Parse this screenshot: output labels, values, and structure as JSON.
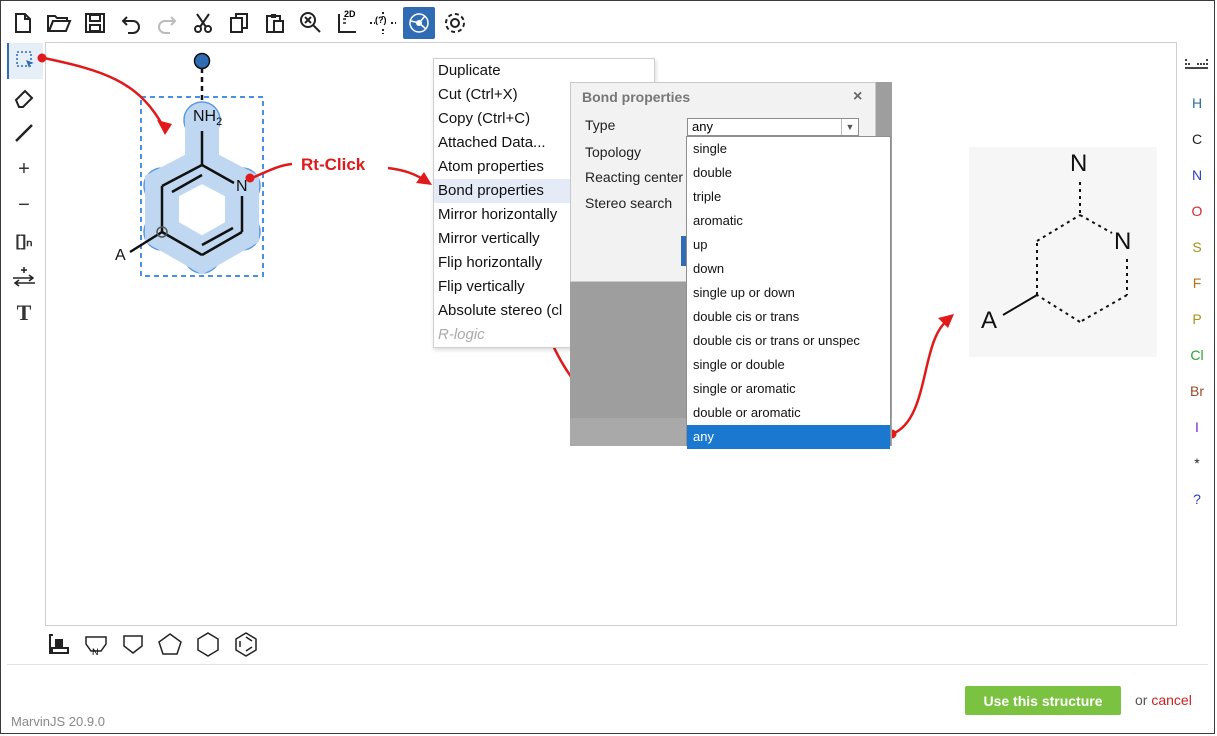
{
  "app": {
    "version": "MarvinJS 20.9.0"
  },
  "toolbar": {
    "icons": [
      "new-document-icon",
      "open-folder-icon",
      "save-icon",
      "undo-icon",
      "redo-icon",
      "cut-icon",
      "copy-icon",
      "paste-icon",
      "zoom-clean-icon",
      "clean-2d-icon",
      "query-icon",
      "active-settings-icon",
      "gear-icon"
    ],
    "clean_2d_label": "2D",
    "query_label": "(?)"
  },
  "left_tools": [
    "select-tool",
    "eraser-tool",
    "bond-tool",
    "charge-plus-tool",
    "charge-minus-tool",
    "bracket-tool",
    "reaction-arrow-tool",
    "text-tool"
  ],
  "left_tool_labels": {
    "charge_plus": "+",
    "charge_minus": "−",
    "bracket": "[]ₙ",
    "text": "T"
  },
  "elements": [
    {
      "symbol": "H",
      "color": "#2e6f9e"
    },
    {
      "symbol": "C",
      "color": "#222222"
    },
    {
      "symbol": "N",
      "color": "#2c3ec9"
    },
    {
      "symbol": "O",
      "color": "#d42a2a"
    },
    {
      "symbol": "S",
      "color": "#a8901a"
    },
    {
      "symbol": "F",
      "color": "#b8701a"
    },
    {
      "symbol": "P",
      "color": "#a8901a"
    },
    {
      "symbol": "Cl",
      "color": "#2aa02a"
    },
    {
      "symbol": "Br",
      "color": "#9a4a2a"
    },
    {
      "symbol": "I",
      "color": "#7a2ac9"
    },
    {
      "symbol": "*",
      "color": "#222222"
    },
    {
      "symbol": "?",
      "color": "#2c3ec9"
    }
  ],
  "annotation": {
    "rt_click": "Rt-Click",
    "color": "#e01a1a"
  },
  "molecule": {
    "nh2": "NH",
    "nh2_sub": "2",
    "n": "N",
    "a": "A"
  },
  "context_menu": {
    "items": [
      "Duplicate",
      "Cut (Ctrl+X)",
      "Copy (Ctrl+C)",
      "Attached Data...",
      "Atom properties",
      "Bond properties",
      "Mirror horizontally",
      "Mirror vertically",
      "Flip horizontally",
      "Flip vertically",
      "Absolute stereo (cl"
    ],
    "disabled_item": "R-logic",
    "highlighted_index": 5
  },
  "bond_dialog": {
    "title": "Bond properties",
    "close": "×",
    "labels": {
      "type": "Type",
      "topology": "Topology",
      "reacting_center": "Reacting center",
      "stereo_search": "Stereo search"
    },
    "type_value": "any",
    "options": [
      "single",
      "double",
      "triple",
      "aromatic",
      "up",
      "down",
      "single up or down",
      "double cis or trans",
      "double cis or trans or unspec",
      "single or double",
      "single or aromatic",
      "double or aromatic",
      "any"
    ],
    "selected_option": "any"
  },
  "result_structure": {
    "n_top": "N",
    "n_ring": "N",
    "a": "A"
  },
  "bottom_tools": [
    "template-icon",
    "pyrrole-template-icon",
    "pentagon-house-icon",
    "pentagon-icon",
    "hexagon-icon",
    "benzene-icon"
  ],
  "bottom_labels": {
    "n": "N"
  },
  "actions": {
    "use_structure": "Use this structure",
    "or": "or",
    "cancel": "cancel"
  },
  "colors": {
    "accent": "#2f6cb4",
    "use_button": "#7bc241",
    "dropdown_selected": "#1b78d0",
    "selection": "#4a90e2"
  }
}
